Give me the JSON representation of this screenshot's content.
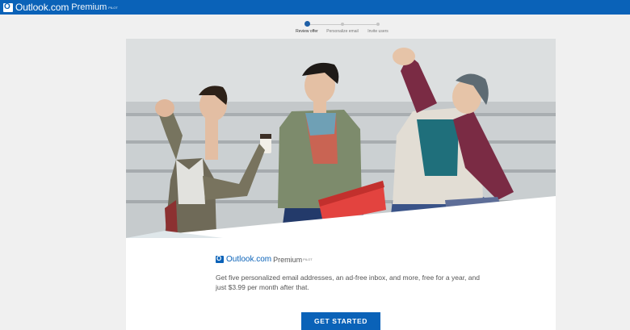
{
  "header": {
    "brand_name": "Outlook.com",
    "brand_premium": "Premium",
    "brand_pilot": "PILOT"
  },
  "steps": [
    {
      "label": "Review offer",
      "active": true
    },
    {
      "label": "Personalize email",
      "active": false
    },
    {
      "label": "Invite users",
      "active": false
    }
  ],
  "offer": {
    "logo_name": "Outlook.com",
    "logo_premium": "Premium",
    "logo_pilot": "PILOT",
    "description": "Get five personalized email addresses, an ad-free inbox, and more, free for a year, and just $3.99 per month after that.",
    "cta_label": "GET STARTED"
  },
  "colors": {
    "brand_blue": "#0a62b8",
    "page_bg": "#f0f0f0"
  },
  "icons": {
    "brand_logo": "outlook-logo-icon"
  }
}
